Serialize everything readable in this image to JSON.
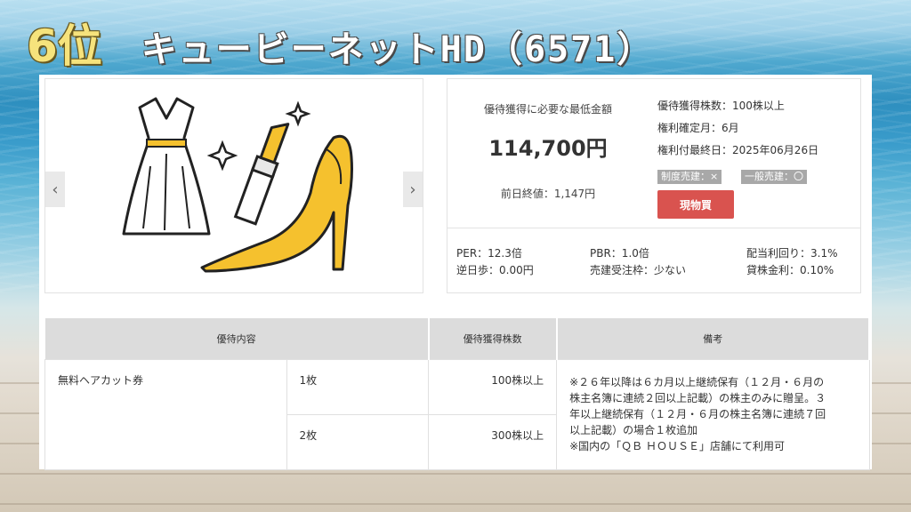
{
  "title": {
    "rank": "6位",
    "company": "キュービーネットHD（6571）"
  },
  "carousel": {
    "prev_icon": "chevron-left-icon",
    "next_icon": "chevron-right-icon",
    "prev_glyph": "‹",
    "next_glyph": "›",
    "illustration": "dress-lipstick-heel-icon"
  },
  "price": {
    "min_label": "優待獲得に必要な最低金額",
    "min_value": "114,700円",
    "prev_close": "前日終値：1,147円"
  },
  "conditions": {
    "shares": "優待獲得株数：100株以上",
    "record_month": "権利確定月：6月",
    "last_date": "権利付最終日：2025年06月26日",
    "tag_system": "制度売建：×",
    "tag_general": "一般売建：〇",
    "buy_button": "現物買"
  },
  "metrics": {
    "per": "PER：12.3倍",
    "pbr": "PBR：1.0倍",
    "dividend_yield": "配当利回り：3.1%",
    "reverse_fee": "逆日歩：0.00円",
    "short_quota": "売建受注枠：少ない",
    "lending_rate": "貸株金利：0.10%"
  },
  "table": {
    "headers": [
      "優待内容",
      "優待獲得株数",
      "備考"
    ],
    "item": "無料ヘアカット券",
    "rows": [
      {
        "quantity": "1枚",
        "shares": "100株以上"
      },
      {
        "quantity": "2枚",
        "shares": "300株以上"
      }
    ],
    "remarks": [
      "※２６年以降は６カ月以上継続保有（１２月・６月の",
      "株主名簿に連続２回以上記載）の株主のみに贈呈。３",
      "年以上継続保有（１２月・６月の株主名簿に連続７回",
      "以上記載）の場合１枚追加",
      "※国内の「ＱＢ ＨＯＵＳＥ」店舗にて利用可"
    ]
  },
  "colors": {
    "rank": "#f6e37c",
    "accent_yellow": "#f5c12e",
    "buy_button": "#d9534f",
    "tag_gray": "#a8a8a8"
  }
}
